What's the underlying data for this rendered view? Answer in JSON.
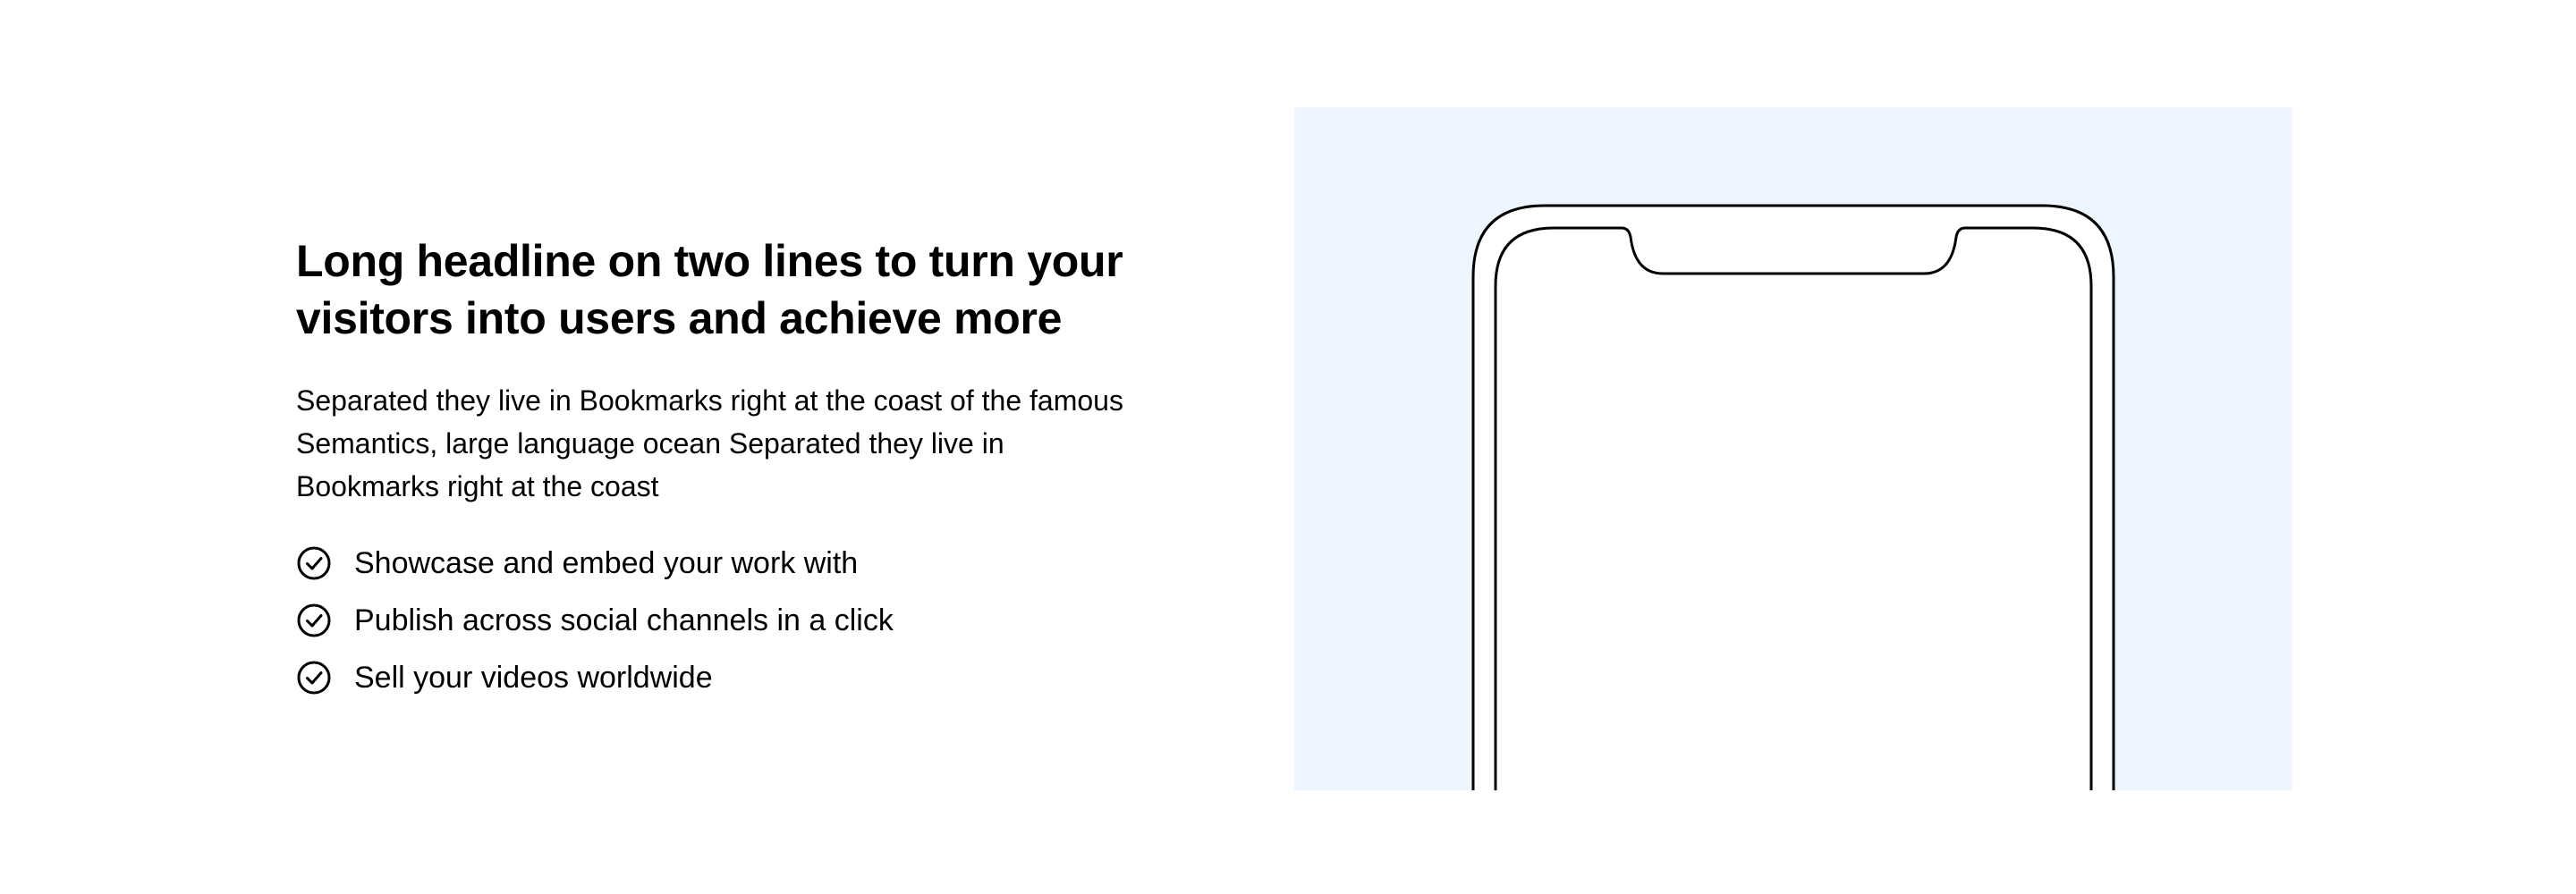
{
  "section": {
    "headline": "Long headline on two lines to turn your visitors into users and achieve more",
    "description": "Separated they live in Bookmarks right at the coast of the famous Semantics, large language ocean Separated they live in Bookmarks right at the coast",
    "features": [
      {
        "label": "Showcase and embed your work with",
        "icon": "check-circle-icon"
      },
      {
        "label": "Publish across social channels in a click",
        "icon": "check-circle-icon"
      },
      {
        "label": "Sell your videos worldwide",
        "icon": "check-circle-icon"
      }
    ]
  },
  "media": {
    "background_color": "#edf5fe",
    "device": "phone-outline"
  },
  "colors": {
    "text": "#000000",
    "panel": "#edf5fe",
    "background": "#ffffff"
  }
}
